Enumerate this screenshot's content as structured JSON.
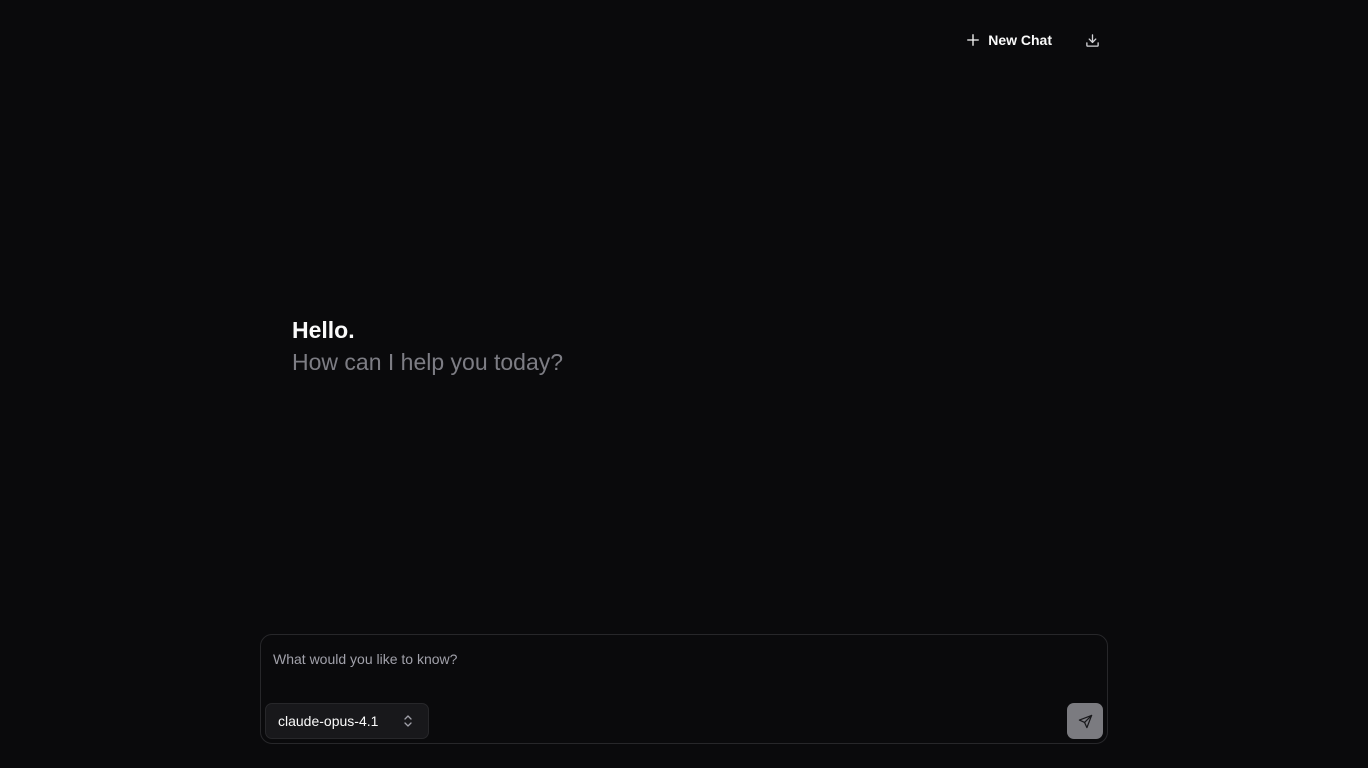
{
  "header": {
    "new_chat_label": "New Chat",
    "new_chat_icon": "plus-icon",
    "download_icon": "download-icon"
  },
  "greeting": {
    "title": "Hello.",
    "subtitle": "How can I help you today?"
  },
  "composer": {
    "placeholder": "What would you like to know?",
    "value": "",
    "model": {
      "selected": "claude-opus-4.1",
      "icon": "chevrons-up-down-icon"
    },
    "send_icon": "send-icon"
  },
  "colors": {
    "background": "#0a0a0c",
    "text_primary": "#fafafa",
    "text_muted": "#7d7d84",
    "border": "#27272a",
    "send_button": "#7b7b80"
  }
}
